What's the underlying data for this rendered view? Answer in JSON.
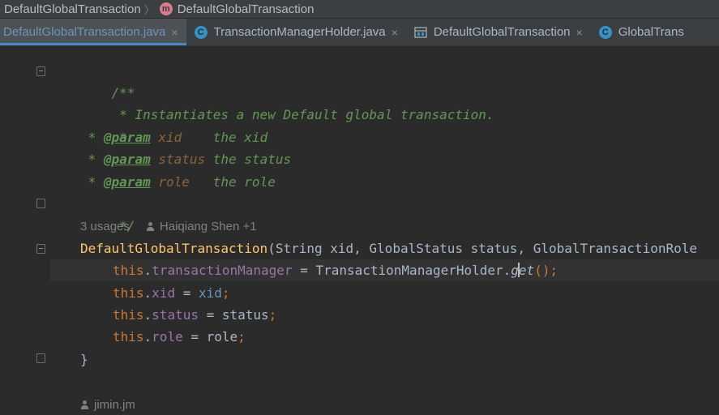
{
  "breadcrumb": {
    "items": [
      "DefaultGlobalTransaction",
      "DefaultGlobalTransaction"
    ],
    "method_icon": "m"
  },
  "tabs": [
    {
      "label": "DefaultGlobalTransaction.java",
      "active": true,
      "icon": "file-icon"
    },
    {
      "label": "TransactionManagerHolder.java",
      "active": false,
      "icon": "class-icon",
      "icon_letter": "C"
    },
    {
      "label": "DefaultGlobalTransaction",
      "active": false,
      "icon": "structure-icon"
    },
    {
      "label": "GlobalTrans",
      "active": false,
      "icon": "class-icon",
      "icon_letter": "C"
    }
  ],
  "close_glyph": "×",
  "code": {
    "doc_open": "/**",
    "doc_desc": " * Instantiates a new Default global transaction.",
    "doc_blank": " *",
    "doc_star": " * ",
    "param_tag": "@param",
    "params": [
      {
        "name": " xid    ",
        "desc": "the xid"
      },
      {
        "name": " status ",
        "desc": "the status"
      },
      {
        "name": " role   ",
        "desc": "the role"
      }
    ],
    "doc_close": " */",
    "usages_hint": "3 usages",
    "author_hint": "Haiqiang Shen +1",
    "ctor_name": "DefaultGlobalTransaction",
    "ctor_args": "(String xid, GlobalStatus status, GlobalTransactionRole",
    "this_kw": "this",
    "body": [
      {
        "field": "transactionManager",
        "rest_a": " = TransactionManagerHolder.",
        "rest_b": "g",
        "rest_c": "et",
        "end": "();"
      },
      {
        "field": "xid",
        "rest": " = ",
        "val": "xid",
        "end": ";"
      },
      {
        "field": "status",
        "rest": " = status",
        "end": ";"
      },
      {
        "field": "role",
        "rest": " = role",
        "end": ";"
      }
    ],
    "brace_close": "}",
    "next_author": "jimin.jm"
  },
  "colors": {
    "background": "#2b2b2b",
    "keyword": "#cc7832",
    "doc_comment": "#629755",
    "function": "#ffc66d",
    "field": "#9876aa"
  }
}
